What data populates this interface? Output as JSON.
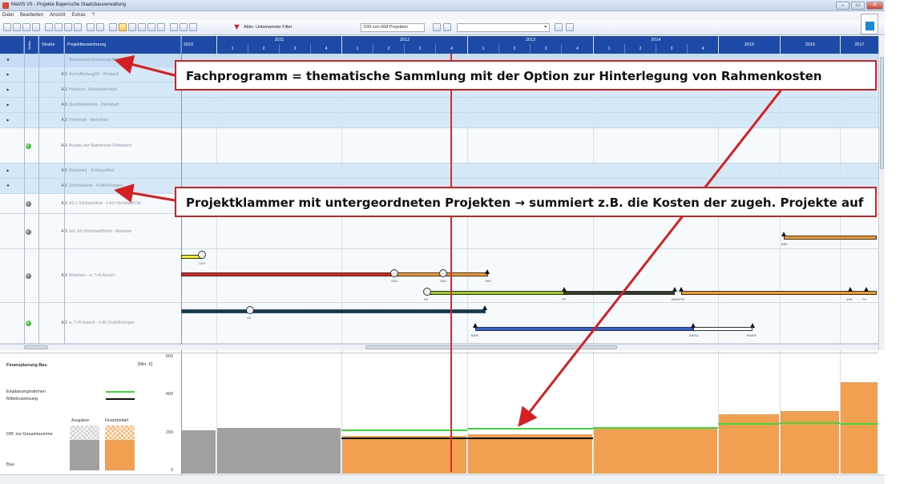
{
  "window": {
    "title": "MaViS V5 - Projekte Bayerische Staatsbauverwaltung",
    "minimize": "–",
    "maximize": "▭",
    "close": "✕"
  },
  "menu": [
    "Datei",
    "Bearbeiten",
    "Ansicht",
    "Extras",
    "?"
  ],
  "toolbar": {
    "filter_label": "Aktiv: Unbenannter Filter",
    "project_count": "639 von 668 Projekten"
  },
  "columns": {
    "status": "Status",
    "street": "Straße",
    "name": "Projektbezeichnung"
  },
  "timeline": {
    "years": [
      {
        "label": "2010"
      },
      {
        "label": "2011",
        "quarters": [
          "1",
          "2",
          "3",
          "4"
        ]
      },
      {
        "label": "2012",
        "quarters": [
          "1",
          "2",
          "3",
          "4"
        ]
      },
      {
        "label": "2013",
        "quarters": [
          "1",
          "2",
          "3",
          "4"
        ]
      },
      {
        "label": "2014",
        "quarters": [
          "1",
          "2",
          "3",
          "4"
        ]
      },
      {
        "label": "2015"
      },
      {
        "label": "2016"
      },
      {
        "label": "2017"
      }
    ]
  },
  "rows": [
    {
      "expander": "▾",
      "status": "",
      "street": "",
      "name": "Bedarfsplan Einstufung A3"
    },
    {
      "expander": "▸",
      "status": "",
      "street": "A 3",
      "name": "Aschaffenburg/W - Hösbach"
    },
    {
      "expander": "▸",
      "status": "",
      "street": "A 3",
      "name": "Hösbach - Marktheidenfeld"
    },
    {
      "expander": "▸",
      "status": "",
      "street": "A 3",
      "name": "Marktheidenfeld - Helmstadt"
    },
    {
      "expander": "▸",
      "status": "",
      "street": "A 3",
      "name": "Helmstadt - Biebelried"
    },
    {
      "expander": "",
      "status": "green",
      "street": "A 3",
      "name": "Ausbau der Mainbrücke Dettelbach"
    },
    {
      "expander": "▸",
      "status": "",
      "street": "A 3",
      "name": "Biebelried - Schlüsselfeld"
    },
    {
      "expander": "▾",
      "status": "",
      "street": "A 3",
      "name": "Schlüsselfeld - Fürth/Erlangen"
    },
    {
      "expander": "",
      "status": "grey",
      "street": "A 3",
      "name": "AS 1 Schlüsselfeld - ö AS Höchstadt/Ost"
    },
    {
      "expander": "",
      "status": "grey",
      "street": "A 3",
      "name": "östl. AS Höchstadt/Nord - Weisham"
    },
    {
      "expander": "",
      "status": "grey",
      "street": "A 3",
      "name": "Weisham - w. T+R Aurach"
    },
    {
      "expander": "",
      "status": "green",
      "street": "A 3",
      "name": "w. T+R Aurach - ö AK Fürth/Erlangen"
    }
  ],
  "milestone_labels": [
    "UVS",
    "VE",
    "VBA",
    "VBV",
    "VBG",
    "PE",
    "PF",
    "APE",
    "PFE",
    "PV",
    "BBV",
    "BWK",
    "BWKA",
    "BWKB"
  ],
  "callouts": {
    "fachprogramm": "Fachprogramm = thematische Sammlung mit der Option zur Hinterlegung von Rahmenkosten",
    "projektklammer": "Projektklammer mit untergeordneten Projekten → summiert z.B. die Kosten der zugeh. Projekte auf"
  },
  "finance": {
    "title": "Finanzplanung Bau",
    "unit": "[Mio. €]",
    "legend_rahmen": "Einplanungsrahmen",
    "legend_mittel": "Mittelzuweisung",
    "col_ausgaben": "Ausgaben",
    "col_finanzbedarf": "Finanzbedarf",
    "row_diff": "Diff. zur Gesamtsumme",
    "row_bau": "Bau",
    "y_ticks": [
      "600",
      "400",
      "200",
      "0"
    ],
    "colors": {
      "ausgaben": "#a0a0a0",
      "finanzbedarf": "#f0a050",
      "rahmen": "#3ddc3d",
      "mittel": "#111111"
    }
  },
  "chart_data": {
    "type": "bar",
    "categories": [
      "2010",
      "2011",
      "2012",
      "2013",
      "2014",
      "2015",
      "2016",
      "2017"
    ],
    "series": [
      {
        "name": "Ausgaben",
        "values": [
          220,
          235,
          0,
          0,
          0,
          0,
          0,
          0
        ]
      },
      {
        "name": "Finanzbedarf",
        "values": [
          0,
          0,
          195,
          200,
          230,
          305,
          320,
          470
        ]
      },
      {
        "name": "Einplanungsrahmen",
        "values": [
          null,
          null,
          220,
          230,
          235,
          255,
          258,
          255
        ]
      },
      {
        "name": "Mittelzuweisung",
        "values": [
          null,
          null,
          180,
          180,
          null,
          null,
          null,
          null
        ]
      }
    ],
    "ylabel": "[Mio. €]",
    "ylim": [
      0,
      600
    ],
    "grid": false
  }
}
